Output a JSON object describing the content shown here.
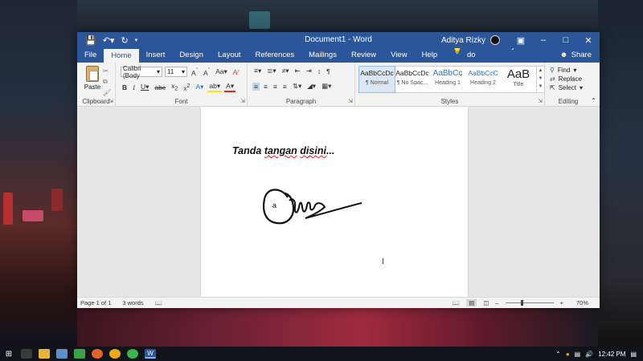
{
  "app": {
    "doc_title": "Document1 - Word",
    "user_name": "Aditya Rizky"
  },
  "tabs": [
    "File",
    "Home",
    "Insert",
    "Design",
    "Layout",
    "References",
    "Mailings",
    "Review",
    "View",
    "Help"
  ],
  "tell_me": "Tell me what you want to do",
  "share_label": "Share",
  "ribbon": {
    "clipboard": {
      "paste_label": "Paste",
      "group_label": "Clipboard"
    },
    "font": {
      "font_name": "Calibri (Body",
      "font_size": "11",
      "group_label": "Font"
    },
    "paragraph": {
      "group_label": "Paragraph"
    },
    "styles": {
      "group_label": "Styles",
      "items": [
        {
          "preview": "AaBbCcDc",
          "name": "¶ Normal"
        },
        {
          "preview": "AaBbCcDc",
          "name": "¶ No Spac..."
        },
        {
          "preview": "AaBbCc",
          "name": "Heading 1"
        },
        {
          "preview": "AaBbCcC",
          "name": "Heading 2"
        },
        {
          "preview": "AaB",
          "name": "Title"
        }
      ]
    },
    "editing": {
      "group_label": "Editing",
      "find": "Find",
      "replace": "Replace",
      "select": "Select"
    }
  },
  "document": {
    "text_plain": "Tanda ",
    "text_spell1": "tangan",
    "text_space": " ",
    "text_spell2": "disini",
    "text_tail": "...",
    "signature_mark": "a"
  },
  "status": {
    "page": "Page 1 of 1",
    "words": "3 words",
    "zoom": "70%",
    "zoom_level_percent": 70
  },
  "taskbar": {
    "time": "12:42 PM"
  }
}
